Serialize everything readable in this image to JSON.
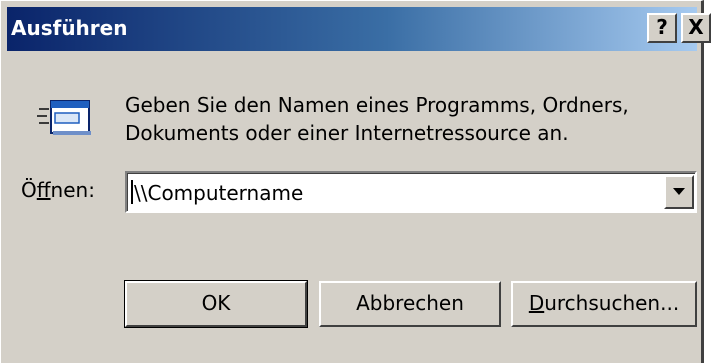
{
  "window": {
    "title": "Ausführen",
    "help_button": "?",
    "close_button": "X"
  },
  "icon": "run-program-icon",
  "description": {
    "line1": "Geben Sie den Namen eines Programms, Ordners,",
    "line2": "Dokuments oder einer Internetressource an."
  },
  "open": {
    "label_prefix": "Ö",
    "label_accel": "f",
    "label_suffix": "fnen:",
    "value": "\\\\Computername"
  },
  "buttons": {
    "ok": "OK",
    "cancel": "Abbrechen",
    "browse_accel": "D",
    "browse_rest": "urchsuchen..."
  },
  "colors": {
    "titlebar_start": "#0a246a",
    "titlebar_end": "#a6caf0",
    "face": "#d4d0c8"
  }
}
